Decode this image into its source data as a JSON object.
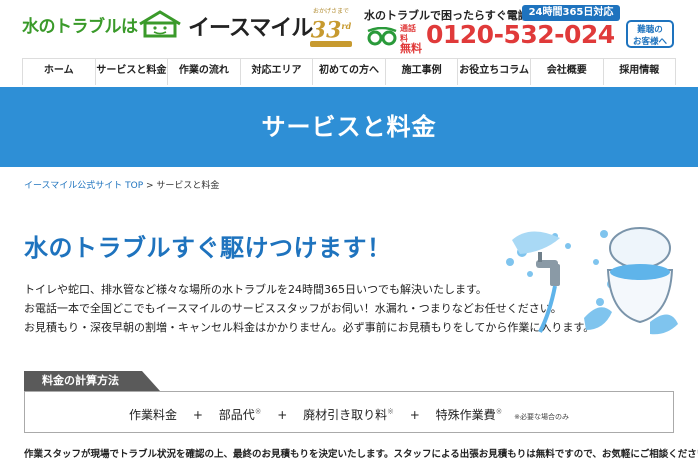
{
  "header": {
    "logo_lead": "水のトラブルは",
    "logo_brand": "イースマイル",
    "anniversary_top": "おかげさまで",
    "anniversary_num": "33",
    "anniversary_suffix": "rd",
    "tagline": "水のトラブルで困ったらすぐ電話!",
    "hours_badge": "24時間365日対応",
    "toll_label_top": "通話料",
    "toll_label_bottom": "無料",
    "phone": "0120-532-024",
    "hearing_line1": "難聴の",
    "hearing_line2": "お客様へ"
  },
  "nav": {
    "items": [
      "ホーム",
      "サービスと料金",
      "作業の流れ",
      "対応エリア",
      "初めての方へ",
      "施工事例",
      "お役立ちコラム",
      "会社概要",
      "採用情報"
    ]
  },
  "hero": {
    "title": "サービスと料金"
  },
  "breadcrumb": {
    "home": "イースマイル公式サイト TOP",
    "sep": " > ",
    "current": "サービスと料金"
  },
  "main": {
    "headline": "水のトラブルすぐ駆けつけます！",
    "desc": [
      "トイレや蛇口、排水管など様々な場所の水トラブルを24時間365日いつでも解決いたします。",
      "お電話一本で全国どこでもイースマイルのサービススタッフがお伺い！水漏れ・つまりなどお任せください。",
      "お見積もり・深夜早朝の割増・キャンセル料金はかかりません。必ず事前にお見積もりをしてから作業に入ります。"
    ]
  },
  "calc": {
    "tab": "料金の計算方法",
    "items": [
      "作業料金",
      "部品代",
      "廃材引き取り料",
      "特殊作業費"
    ],
    "plus": "+",
    "mark": "※",
    "note": "※必要な場合のみ"
  },
  "footnote": "作業スタッフが現場でトラブル状況を確認の上、最終のお見積もりを決定いたします。スタッフによる出張お見積もりは無料ですので、お気軽にご相談ください。",
  "colors": {
    "brand_green": "#3a9a2a",
    "brand_blue": "#1e73be",
    "hero_blue": "#2e8fd6",
    "phone_red": "#e03a3a",
    "gold": "#c79a2f"
  }
}
